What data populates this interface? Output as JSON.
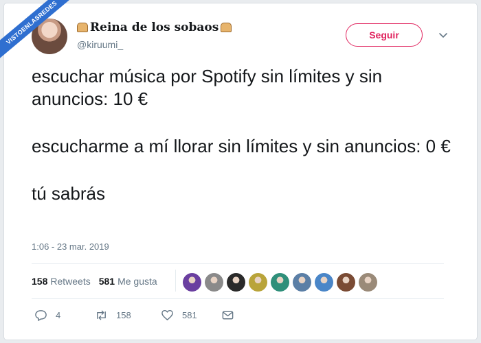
{
  "watermark": "VISTOENLASREDES",
  "user": {
    "display_name": "Reina de los sobaos",
    "handle": "@kiruumi_"
  },
  "follow_button": "Seguir",
  "tweet": {
    "paragraphs": [
      "escuchar música por Spotify sin límites y sin anuncios: 10 €",
      "escucharme a mí llorar sin límites y sin anuncios: 0 €",
      "tú sabrás"
    ],
    "timestamp": "1:06 - 23 mar. 2019"
  },
  "stats": {
    "retweets_count": "158",
    "retweets_label": "Retweets",
    "likes_count": "581",
    "likes_label": "Me gusta"
  },
  "liker_colors": [
    "#6a3fa0",
    "#8a8a8a",
    "#2a2a2a",
    "#b9a43a",
    "#2f8f7a",
    "#5b7fa6",
    "#4a86c8",
    "#7a4b34",
    "#9a8a78"
  ],
  "actions": {
    "replies": "4",
    "retweets": "158",
    "likes": "581"
  },
  "colors": {
    "accent": "#e0245e",
    "muted": "#657786",
    "text": "#14171a"
  }
}
